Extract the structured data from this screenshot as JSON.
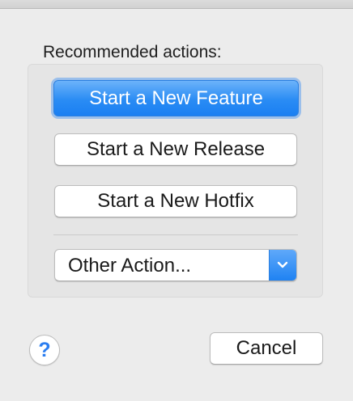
{
  "dialog": {
    "section_label": "Recommended actions:",
    "actions": {
      "start_feature_label": "Start a New Feature",
      "start_release_label": "Start a New Release",
      "start_hotfix_label": "Start a New Hotfix"
    },
    "other_action_select": {
      "selected_value": "Other Action..."
    },
    "help_label": "?",
    "cancel_label": "Cancel"
  },
  "colors": {
    "default_button": "#2a8cf4",
    "popup_arrows": "#1f82f2",
    "help_glyph": "#2b7ef0",
    "background": "#ececec"
  },
  "icons": {
    "popup_arrows": "chevron-down-icon",
    "help": "help-icon"
  }
}
